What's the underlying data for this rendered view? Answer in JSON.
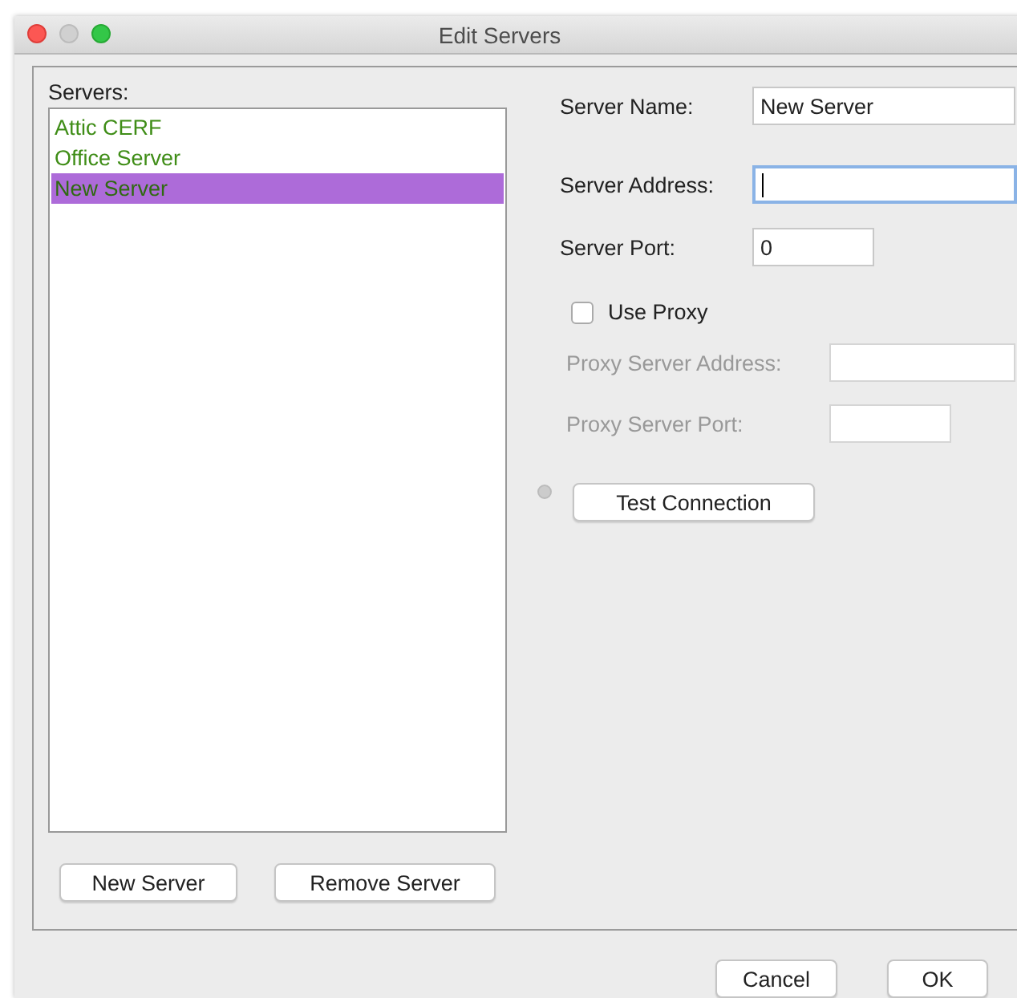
{
  "window": {
    "title": "Edit Servers"
  },
  "servers": {
    "label": "Servers:",
    "items": [
      {
        "name": "Attic CERF",
        "selected": false
      },
      {
        "name": "Office Server",
        "selected": false
      },
      {
        "name": "New Server",
        "selected": true
      }
    ],
    "buttons": [
      "New Server",
      "Remove Server"
    ]
  },
  "form": {
    "server_name": {
      "label": "Server Name:",
      "value": "New Server"
    },
    "server_address": {
      "label": "Server Address:",
      "focused": true
    },
    "server_port": {
      "label": "Server Port:",
      "value": "0"
    },
    "use_proxy": {
      "label": "Use Proxy",
      "checked": false
    },
    "proxy_address": {
      "label": "Proxy Server Address:",
      "disabled": true
    },
    "proxy_port": {
      "label": "Proxy Server Port:",
      "disabled": true
    },
    "test_button": "Test Connection"
  },
  "buttons": [
    "Cancel",
    "OK"
  ]
}
